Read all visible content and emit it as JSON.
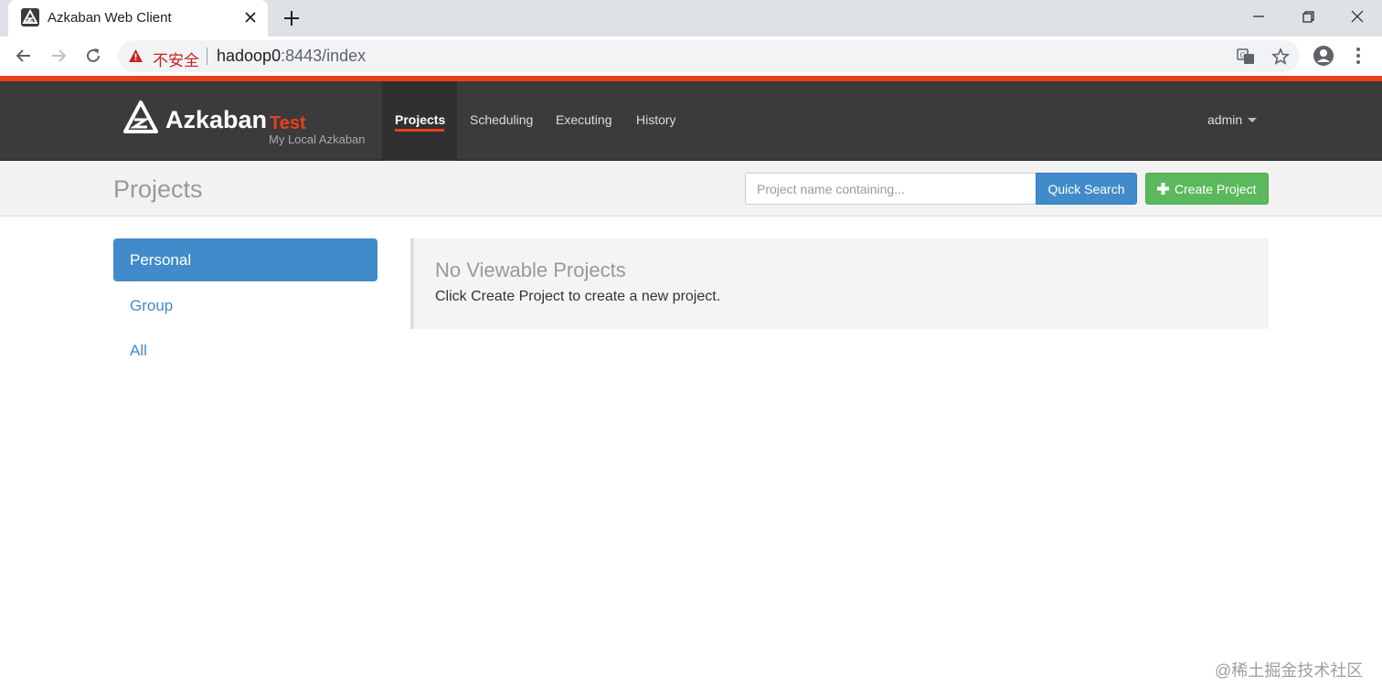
{
  "browser": {
    "tab_title": "Azkaban Web Client",
    "security_label": "不安全",
    "url_host": "hadoop0",
    "url_rest": ":8443/index"
  },
  "header": {
    "brand": "Azkaban",
    "environment": "Test",
    "subtitle": "My Local Azkaban",
    "nav": [
      {
        "label": "Projects",
        "active": true
      },
      {
        "label": "Scheduling",
        "active": false
      },
      {
        "label": "Executing",
        "active": false
      },
      {
        "label": "History",
        "active": false
      }
    ],
    "user": "admin"
  },
  "page": {
    "title": "Projects",
    "search_placeholder": "Project name containing...",
    "quick_search_label": "Quick Search",
    "create_label": "Create Project"
  },
  "sidebar": {
    "items": [
      {
        "label": "Personal",
        "active": true
      },
      {
        "label": "Group",
        "active": false
      },
      {
        "label": "All",
        "active": false
      }
    ]
  },
  "empty_state": {
    "title": "No Viewable Projects",
    "message": "Click Create Project to create a new project."
  },
  "watermark": "@稀土掘金技术社区",
  "colors": {
    "accent": "#e8401c",
    "navbar": "#3b3b3b",
    "primary": "#428bca",
    "success": "#5cb85c"
  }
}
